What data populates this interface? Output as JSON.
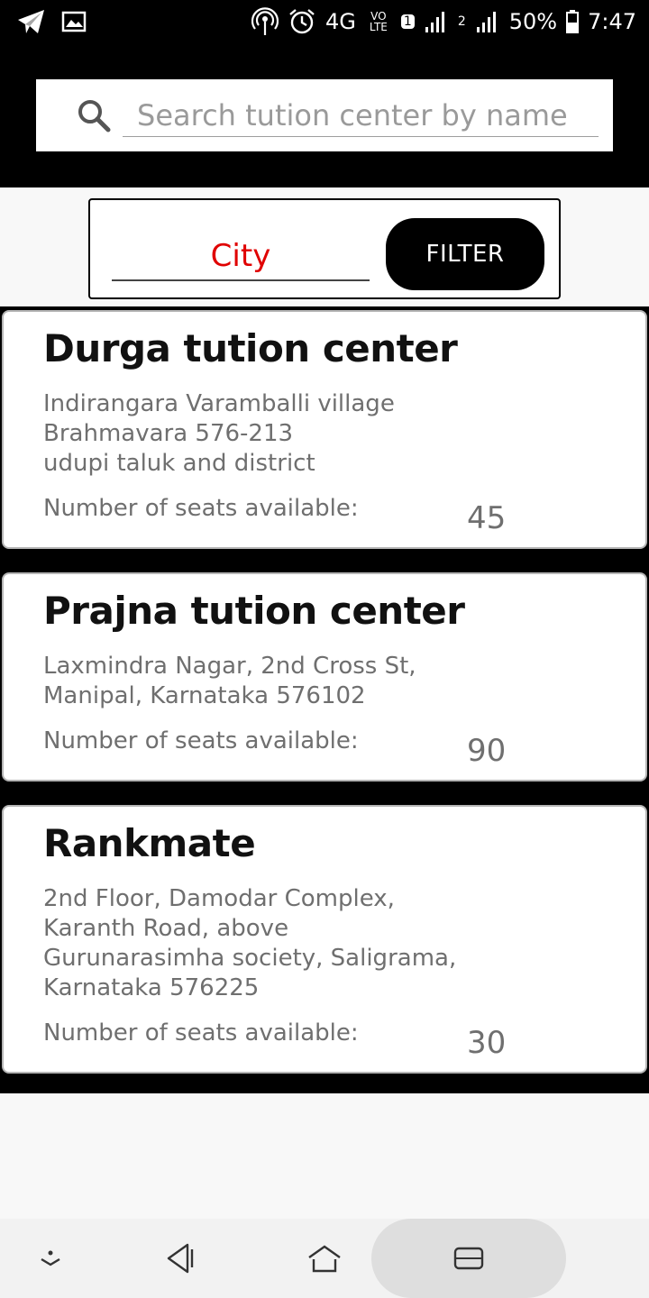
{
  "status_bar": {
    "network": "4G",
    "volte": "VO LTE",
    "sim1_badge": "1",
    "sim2_badge": "2",
    "battery": "50%",
    "time": "7:47"
  },
  "search": {
    "placeholder": "Search tution center by name",
    "value": ""
  },
  "filter": {
    "city_placeholder": "City",
    "button_label": "FILTER"
  },
  "seats_label": "Number of seats available:",
  "centers": [
    {
      "name": "Durga tution center",
      "address": "Indirangara Varamballi village\nBrahmavara 576-213\nudupi taluk and district",
      "seats": "45"
    },
    {
      "name": "Prajna tution center",
      "address": "Laxmindra Nagar, 2nd Cross St,\nManipal, Karnataka 576102",
      "seats": "90"
    },
    {
      "name": "Rankmate",
      "address": "2nd Floor, Damodar Complex,\nKaranth Road, above\nGurunarasimha society, Saligrama,\nKarnataka 576225",
      "seats": "30"
    }
  ],
  "colors": {
    "header_bg": "#000000",
    "city_text": "#e00000",
    "filter_button_bg": "#000000"
  },
  "icons": {
    "status_left": [
      "telegram-icon",
      "image-icon"
    ],
    "status_right": [
      "hotspot-icon",
      "alarm-icon",
      "signal-icon",
      "battery-icon"
    ],
    "search": "search-icon",
    "nav": [
      "hide-keyboard-icon",
      "back-icon",
      "home-icon",
      "recents-icon"
    ]
  }
}
